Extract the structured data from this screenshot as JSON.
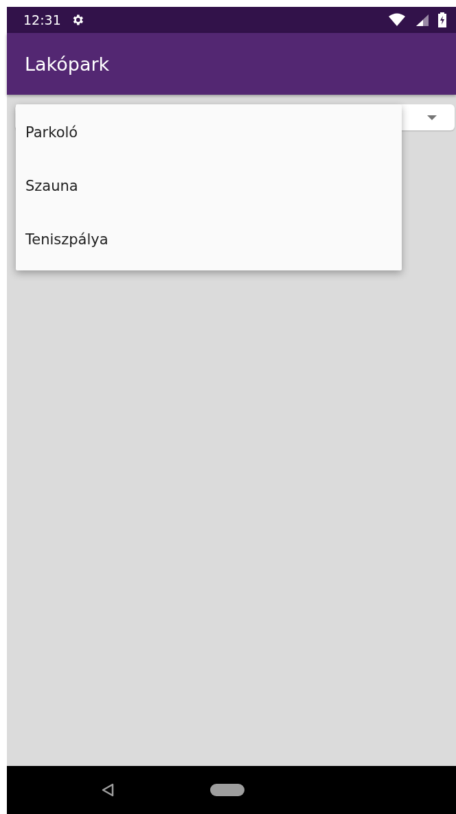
{
  "status_bar": {
    "time": "12:31"
  },
  "app_bar": {
    "title": "Lakópark"
  },
  "spinner": {
    "expanded": true,
    "options": [
      {
        "label": "Parkoló"
      },
      {
        "label": "Szauna"
      },
      {
        "label": "Teniszpálya"
      }
    ]
  }
}
